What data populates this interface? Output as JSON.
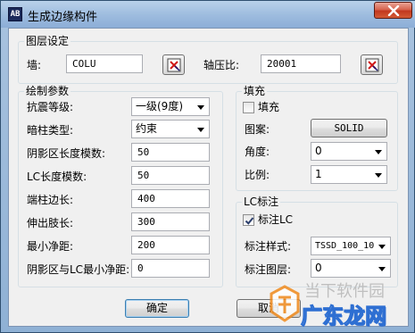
{
  "window": {
    "title": "生成边缘构件",
    "icon_text": "AB"
  },
  "layer": {
    "group_title": "图层设定",
    "wall_label": "墙:",
    "wall_value": "COLU",
    "ratio_label": "轴压比:",
    "ratio_value": "20001"
  },
  "draw": {
    "group_title": "绘制参数",
    "seismic_label": "抗震等级:",
    "seismic_value": "一级(9度)",
    "hidden_label": "暗柱类型:",
    "hidden_value": "约束",
    "shade_len_label": "阴影区长度模数:",
    "shade_len_value": "50",
    "lc_len_label": "LC长度模数:",
    "lc_len_value": "50",
    "end_label": "端柱边长:",
    "end_value": "400",
    "limb_label": "伸出肢长:",
    "limb_value": "300",
    "min_label": "最小净距:",
    "min_value": "200",
    "shade_lc_label": "阴影区与LC最小净距:",
    "shade_lc_value": "0"
  },
  "fill": {
    "group_title": "填充",
    "fill_check_label": "填充",
    "fill_checked": false,
    "pattern_label": "图案:",
    "pattern_value": "SOLID",
    "angle_label": "角度:",
    "angle_value": "0",
    "scale_label": "比例:",
    "scale_value": "1"
  },
  "lc": {
    "group_title": "LC标注",
    "mark_label": "标注LC",
    "mark_checked": true,
    "style_label": "标注样式:",
    "style_value": "TSSD_100_10",
    "layer_label": "标注图层:",
    "layer_value": "0"
  },
  "buttons": {
    "ok": "确定",
    "cancel": "取消"
  },
  "watermark": {
    "top_text": "当下软件园",
    "main_text": "广东龙网"
  },
  "colors": {
    "accent": "#3c7fb1",
    "close_red": "#c2381f",
    "watermark_blue": "#2e6fd2"
  }
}
